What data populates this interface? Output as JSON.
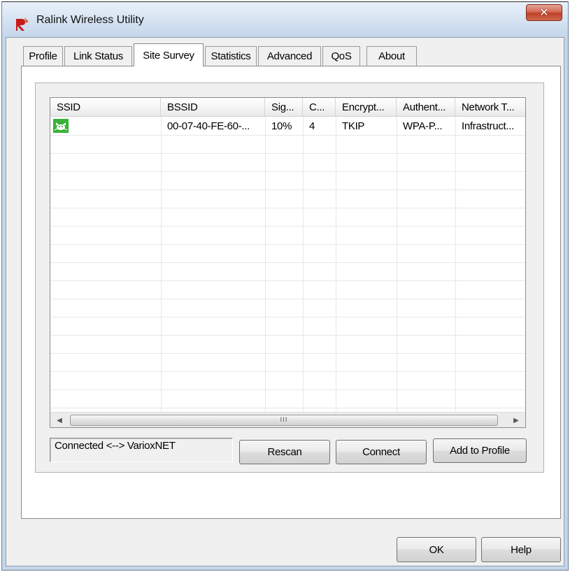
{
  "window": {
    "title": "Ralink Wireless Utility"
  },
  "tabs": [
    {
      "label": "Profile"
    },
    {
      "label": "Link Status"
    },
    {
      "label": "Site Survey"
    },
    {
      "label": "Statistics"
    },
    {
      "label": "Advanced"
    },
    {
      "label": "QoS"
    },
    {
      "label": "About"
    }
  ],
  "active_tab": "Site Survey",
  "site_survey": {
    "columns": [
      "SSID",
      "BSSID",
      "Sig...",
      "C...",
      "Encrypt...",
      "Authent...",
      "Network T..."
    ],
    "rows": [
      {
        "ssid": "",
        "bssid": "00-07-40-FE-60-...",
        "signal": "10%",
        "channel": "4",
        "encryption": "TKIP",
        "authentication": "WPA-P...",
        "network_type": "Infrastruct...",
        "icon": "wireless-network-icon"
      }
    ],
    "status_text": "Connected <--> VarioxNET",
    "scroll_grip": "III",
    "buttons": {
      "rescan": "Rescan",
      "connect": "Connect",
      "add_to_profile": "Add to Profile"
    }
  },
  "footer_buttons": {
    "ok": "OK",
    "help": "Help"
  },
  "icons": {
    "close": "close-icon",
    "logo": "ralink-logo-icon",
    "scroll_left": "scroll-left-arrow-icon",
    "scroll_right": "scroll-right-arrow-icon"
  },
  "colors": {
    "close_button": "#c74a31",
    "title_bar": "#d4e2f1",
    "network_icon": "#38b238"
  }
}
